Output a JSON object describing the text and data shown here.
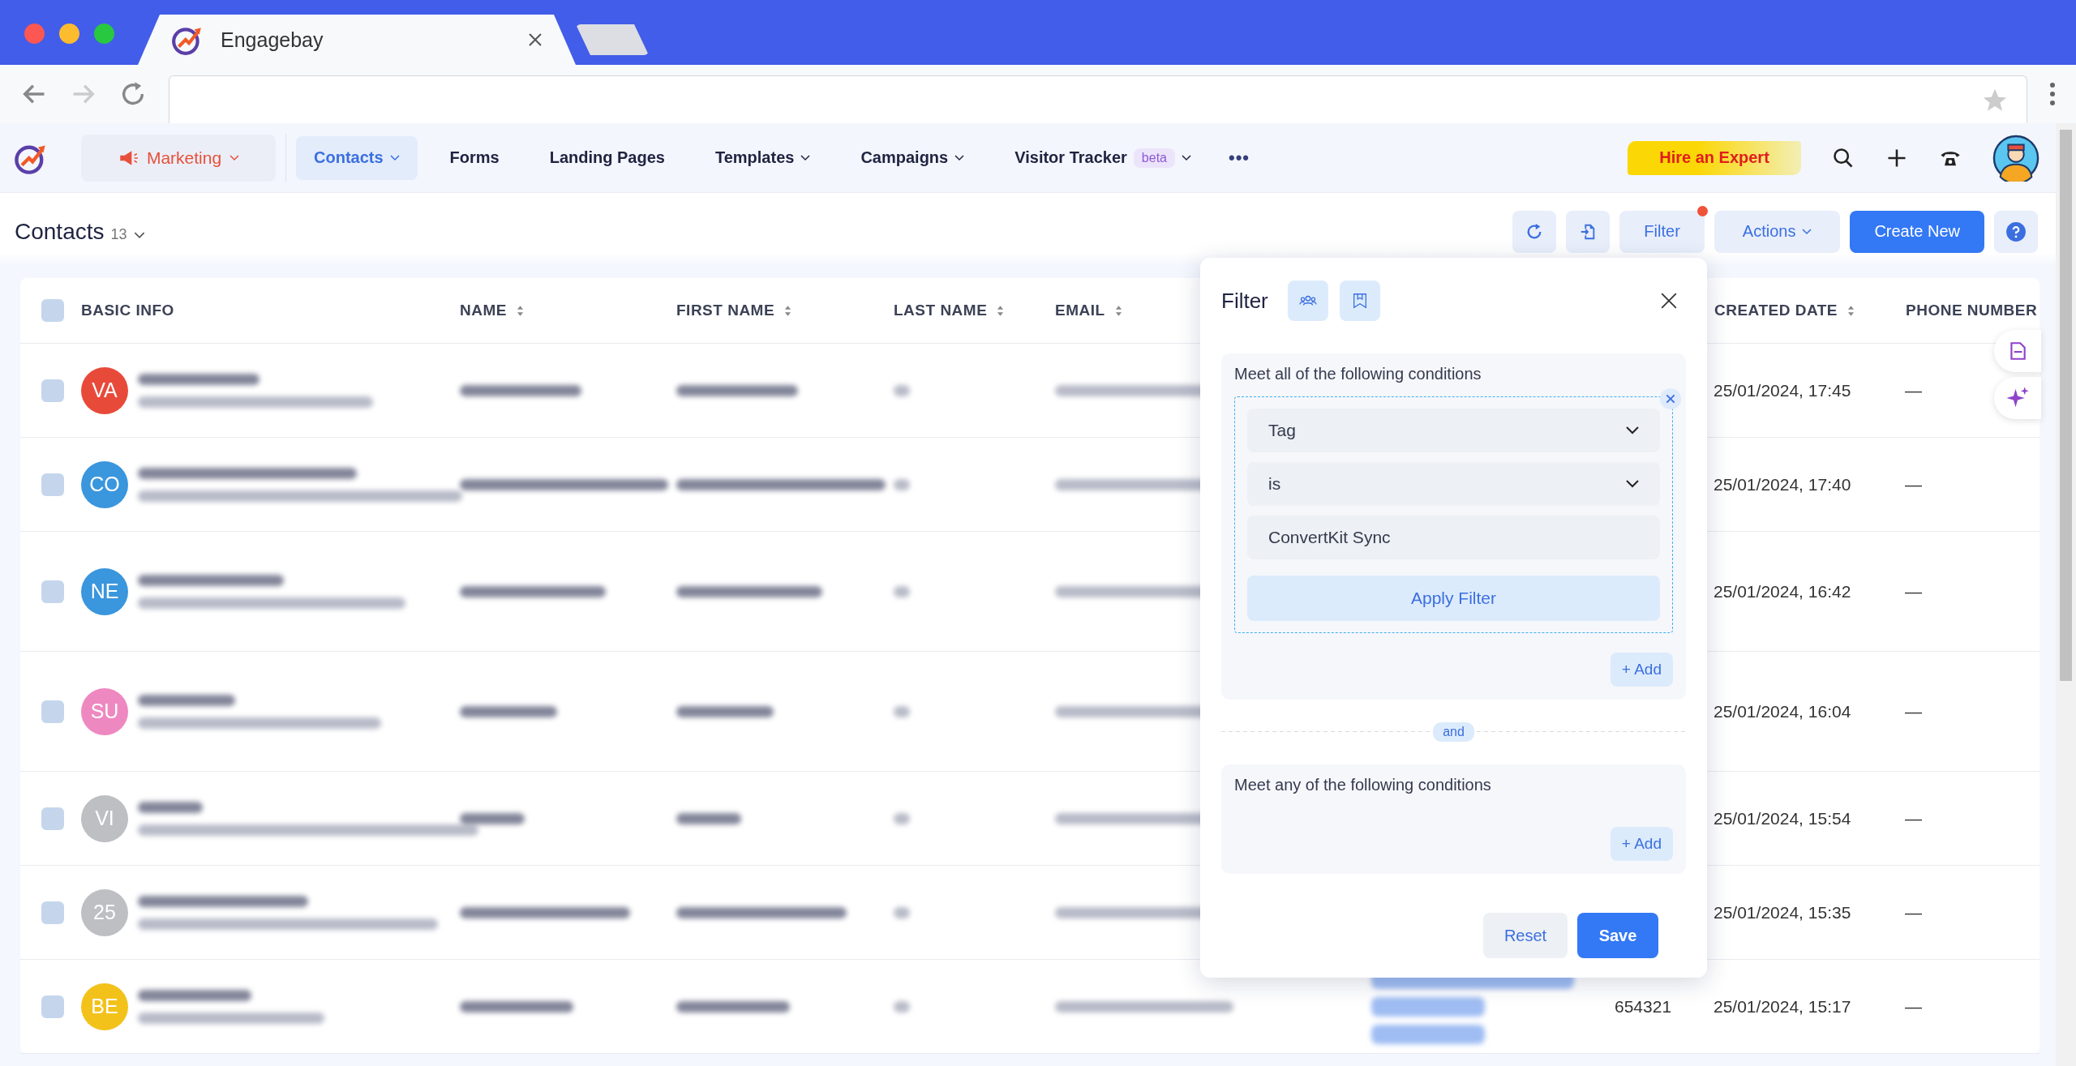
{
  "browser": {
    "tab_title": "Engagebay"
  },
  "nav": {
    "module": {
      "label": "Marketing"
    },
    "items": [
      {
        "label": "Contacts",
        "selected": true,
        "dropdown": true
      },
      {
        "label": "Forms",
        "selected": false,
        "dropdown": false
      },
      {
        "label": "Landing Pages",
        "selected": false,
        "dropdown": false
      },
      {
        "label": "Templates",
        "selected": false,
        "dropdown": true
      },
      {
        "label": "Campaigns",
        "selected": false,
        "dropdown": true
      },
      {
        "label": "Visitor Tracker",
        "selected": false,
        "dropdown": true,
        "badge": "beta"
      }
    ],
    "more": "•••",
    "hire_button": "Hire an Expert"
  },
  "header": {
    "title": "Contacts",
    "count": "13",
    "filter_button": {
      "label": "Filter",
      "has_dot": true
    },
    "actions_button": "Actions",
    "create_button": "Create New"
  },
  "table": {
    "select_all_checked": false,
    "columns": [
      {
        "label": "BASIC INFO",
        "sortable": false
      },
      {
        "label": "NAME",
        "sortable": true
      },
      {
        "label": "FIRST NAME",
        "sortable": true
      },
      {
        "label": "LAST NAME",
        "sortable": true
      },
      {
        "label": "EMAIL",
        "sortable": true
      },
      {
        "label": "CREATED DATE",
        "sortable": true
      },
      {
        "label": "PHONE NUMBER",
        "sortable": false
      }
    ],
    "rows": [
      {
        "initials": "VA",
        "color": "#e84a3a",
        "created": "25/01/2024, 17:45",
        "phone": "—",
        "checked": false
      },
      {
        "initials": "CO",
        "color": "#3a96dd",
        "created": "25/01/2024, 17:40",
        "phone": "—",
        "checked": false
      },
      {
        "initials": "NE",
        "color": "#3a96dd",
        "created": "25/01/2024, 16:42",
        "phone": "—",
        "checked": false
      },
      {
        "initials": "SU",
        "color": "#ee88c0",
        "created": "25/01/2024, 16:04",
        "phone": "—",
        "checked": false
      },
      {
        "initials": "VI",
        "color": "#bdbfc2",
        "created": "25/01/2024, 15:54",
        "phone": "—",
        "checked": false
      },
      {
        "initials": "25",
        "color": "#bdbfc2",
        "created": "25/01/2024, 15:35",
        "phone": "—",
        "checked": false
      },
      {
        "initials": "BE",
        "color": "#f2c21b",
        "has_tags": true,
        "column_7": "654321",
        "created": "25/01/2024, 15:17",
        "phone": "—",
        "checked": false
      }
    ]
  },
  "filter_panel": {
    "title": "Filter",
    "all_group": {
      "title": "Meet all of the following conditions",
      "conditions": [
        {
          "field": "Tag",
          "operator": "is",
          "value": "ConvertKit Sync",
          "apply": "Apply Filter"
        }
      ],
      "add": "+ Add"
    },
    "joiner": "and",
    "any_group": {
      "title": "Meet any of the following conditions",
      "add": "+ Add"
    },
    "reset": "Reset",
    "save": "Save"
  }
}
